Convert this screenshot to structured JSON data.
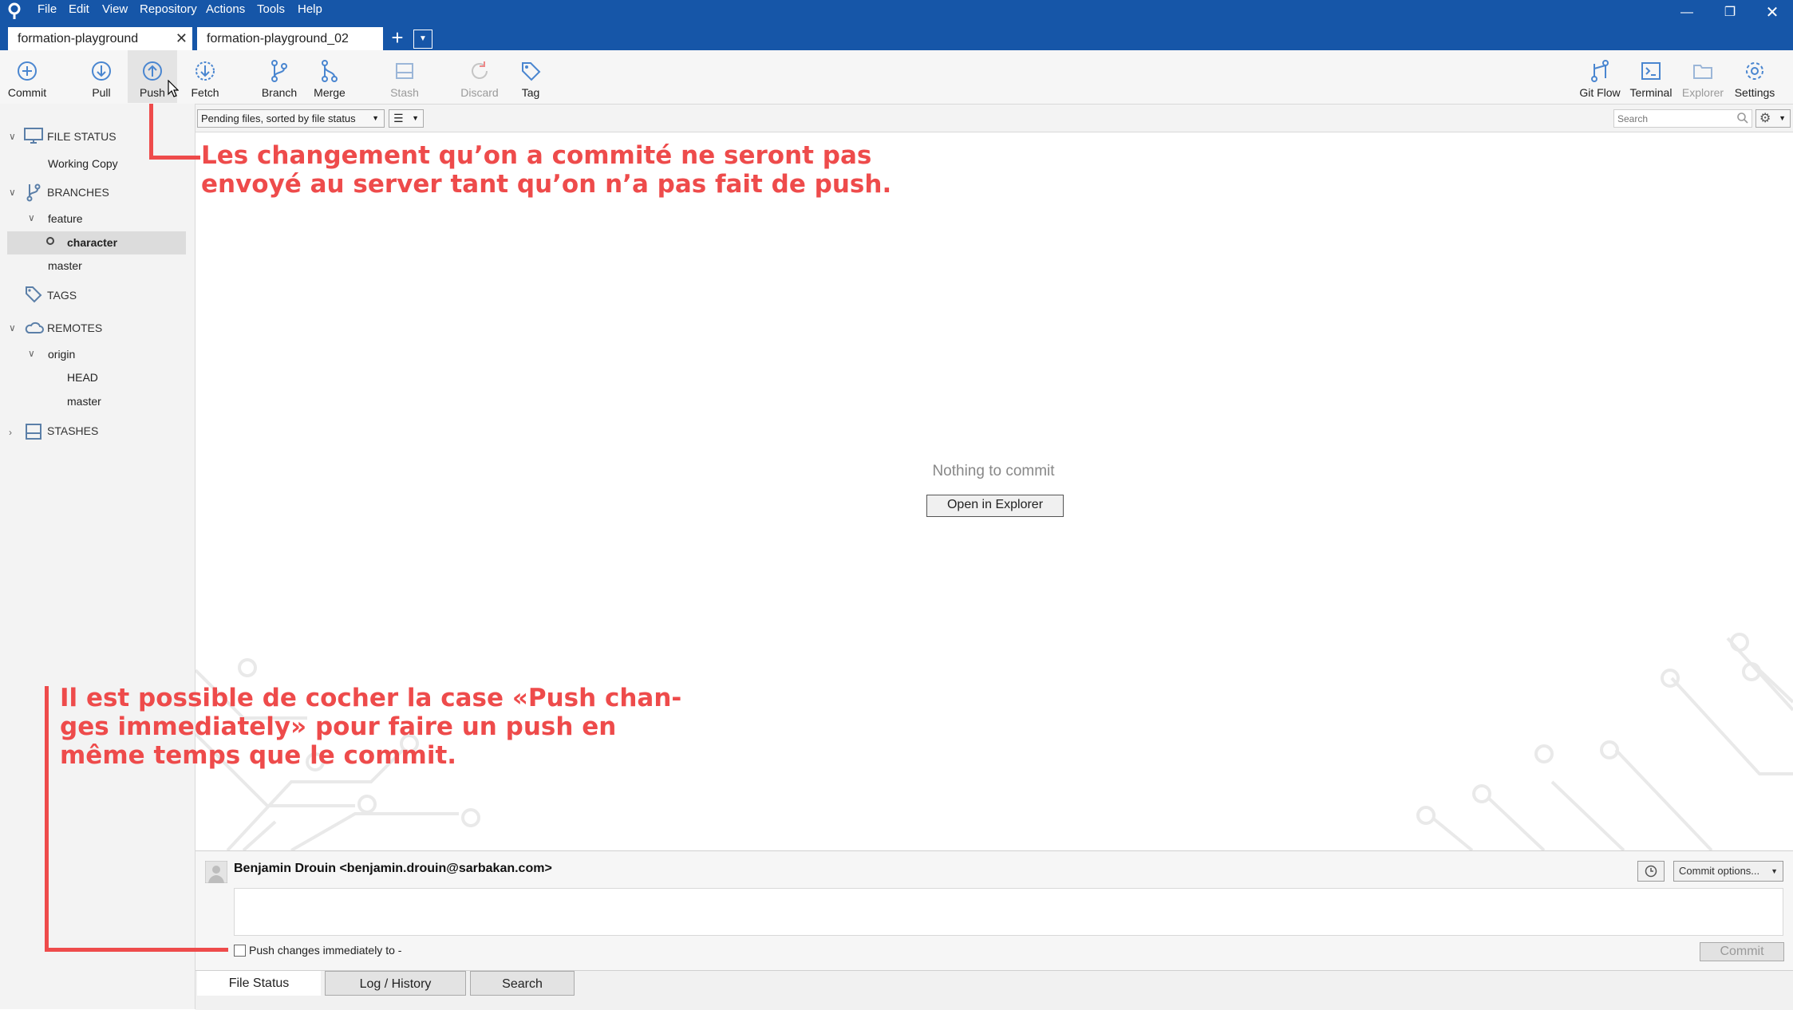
{
  "menu": {
    "items": [
      "File",
      "Edit",
      "View",
      "Repository",
      "Actions",
      "Tools",
      "Help"
    ]
  },
  "tabs": {
    "active": "formation-playground",
    "second": "formation-playground_02"
  },
  "toolbar": {
    "commit": "Commit",
    "pull": "Pull",
    "push": "Push",
    "fetch": "Fetch",
    "branch": "Branch",
    "merge": "Merge",
    "stash": "Stash",
    "discard": "Discard",
    "tag": "Tag",
    "git_flow": "Git Flow",
    "terminal": "Terminal",
    "explorer": "Explorer",
    "settings": "Settings"
  },
  "sidebar": {
    "file_status": "FILE STATUS",
    "working_copy": "Working Copy",
    "branches": "BRANCHES",
    "feature": "feature",
    "character": "character",
    "master": "master",
    "tags": "TAGS",
    "remotes": "REMOTES",
    "origin": "origin",
    "head": "HEAD",
    "origin_master": "master",
    "stashes": "STASHES"
  },
  "filter": {
    "select": "Pending files, sorted by file status",
    "search_placeholder": "Search"
  },
  "main": {
    "empty": "Nothing to commit",
    "open_explorer": "Open in Explorer"
  },
  "commit": {
    "author": "Benjamin Drouin <benjamin.drouin@sarbakan.com>",
    "options": "Commit options...",
    "push_label": "Push changes immediately to -",
    "button": "Commit"
  },
  "bottom_tabs": {
    "file_status": "File Status",
    "log": "Log / History",
    "search": "Search"
  },
  "annotations": {
    "top": "Les changement qu’on a commité ne seront pas\nenvoyé au server tant qu’on n’a pas fait de push.",
    "bottom": "Il est possible de cocher la case «Push chan-\nges immediately» pour faire un push en\nmême temps que le commit."
  },
  "colors": {
    "titlebar": "#1656a8",
    "annotation": "#ee4b4b",
    "icon": "#4a86d0"
  }
}
